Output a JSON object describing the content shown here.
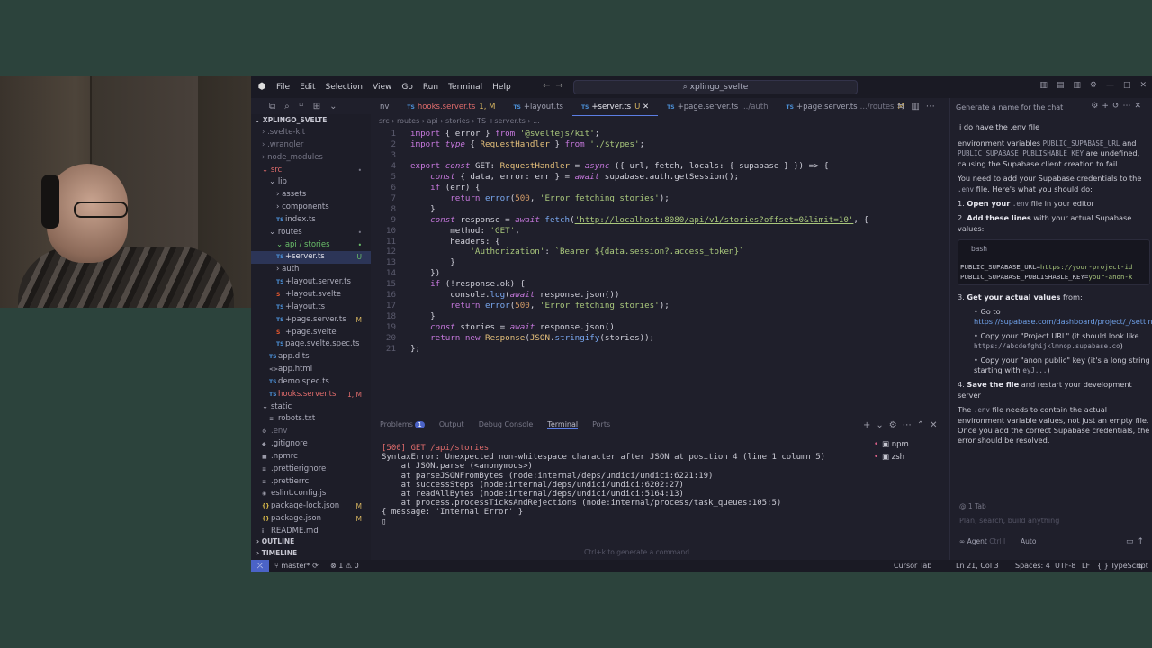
{
  "app": {
    "menu": [
      "File",
      "Edit",
      "Selection",
      "View",
      "Go",
      "Run",
      "Terminal",
      "Help"
    ],
    "search_text": "xplingo_svelte"
  },
  "tabs": [
    {
      "name": "nv",
      "sub": "",
      "mod": "",
      "active": false
    },
    {
      "name": "hooks.server.ts",
      "sub": "",
      "mod": "1, M",
      "active": false
    },
    {
      "name": "+layout.ts",
      "sub": "",
      "mod": "",
      "active": false
    },
    {
      "name": "+server.ts",
      "sub": "",
      "mod": "U",
      "active": true
    },
    {
      "name": "+page.server.ts",
      "sub": ".../auth",
      "mod": "",
      "active": false
    },
    {
      "name": "+page.server.ts",
      "sub": ".../routes",
      "mod": "M",
      "active": false
    }
  ],
  "breadcrumb": "src › routes › api › stories › TS +server.ts › ...",
  "explorer": {
    "title": "XPLINGO_SVELTE",
    "rows": [
      {
        "label": "› .svelte-kit",
        "indent": 1,
        "icon": "",
        "cls": "dim",
        "badge": ""
      },
      {
        "label": "› .wrangler",
        "indent": 1,
        "icon": "",
        "cls": "dim",
        "badge": ""
      },
      {
        "label": "› node_modules",
        "indent": 1,
        "icon": "",
        "cls": "dim",
        "badge": ""
      },
      {
        "label": "⌄ src",
        "indent": 1,
        "icon": "",
        "cls": "red",
        "badge": "•"
      },
      {
        "label": "⌄ lib",
        "indent": 2,
        "icon": "",
        "cls": "",
        "badge": ""
      },
      {
        "label": "› assets",
        "indent": 3,
        "icon": "",
        "cls": "",
        "badge": ""
      },
      {
        "label": "› components",
        "indent": 3,
        "icon": "",
        "cls": "",
        "badge": ""
      },
      {
        "label": "index.ts",
        "indent": 3,
        "icon": "TS",
        "cls": "",
        "badge": ""
      },
      {
        "label": "⌄ routes",
        "indent": 2,
        "icon": "",
        "cls": "",
        "badge": "•"
      },
      {
        "label": "⌄ api / stories",
        "indent": 3,
        "icon": "",
        "cls": "green",
        "badge": "•"
      },
      {
        "label": "+server.ts",
        "indent": 3,
        "icon": "TS",
        "cls": "sel",
        "badge": "U"
      },
      {
        "label": "› auth",
        "indent": 3,
        "icon": "",
        "cls": "",
        "badge": ""
      },
      {
        "label": "+layout.server.ts",
        "indent": 3,
        "icon": "TS",
        "cls": "",
        "badge": ""
      },
      {
        "label": "+layout.svelte",
        "indent": 3,
        "icon": "S",
        "cls": "",
        "badge": ""
      },
      {
        "label": "+layout.ts",
        "indent": 3,
        "icon": "TS",
        "cls": "",
        "badge": ""
      },
      {
        "label": "+page.server.ts",
        "indent": 3,
        "icon": "TS",
        "cls": "",
        "badge": "M"
      },
      {
        "label": "+page.svelte",
        "indent": 3,
        "icon": "S",
        "cls": "",
        "badge": ""
      },
      {
        "label": "page.svelte.spec.ts",
        "indent": 3,
        "icon": "TS",
        "cls": "",
        "badge": ""
      },
      {
        "label": "app.d.ts",
        "indent": 2,
        "icon": "TS",
        "cls": "",
        "badge": ""
      },
      {
        "label": "app.html",
        "indent": 2,
        "icon": "<>",
        "cls": "",
        "badge": ""
      },
      {
        "label": "demo.spec.ts",
        "indent": 2,
        "icon": "TS",
        "cls": "",
        "badge": ""
      },
      {
        "label": "hooks.server.ts",
        "indent": 2,
        "icon": "TS",
        "cls": "red",
        "badge": "1, M"
      },
      {
        "label": "⌄ static",
        "indent": 1,
        "icon": "",
        "cls": "",
        "badge": ""
      },
      {
        "label": "robots.txt",
        "indent": 2,
        "icon": "≡",
        "cls": "",
        "badge": ""
      },
      {
        "label": ".env",
        "indent": 1,
        "icon": "⚙",
        "cls": "dim",
        "badge": ""
      },
      {
        "label": ".gitignore",
        "indent": 1,
        "icon": "◆",
        "cls": "",
        "badge": ""
      },
      {
        "label": ".npmrc",
        "indent": 1,
        "icon": "■",
        "cls": "",
        "badge": ""
      },
      {
        "label": ".prettierignore",
        "indent": 1,
        "icon": "≡",
        "cls": "",
        "badge": ""
      },
      {
        "label": ".prettierrc",
        "indent": 1,
        "icon": "≡",
        "cls": "",
        "badge": ""
      },
      {
        "label": "eslint.config.js",
        "indent": 1,
        "icon": "◉",
        "cls": "",
        "badge": ""
      },
      {
        "label": "package-lock.json",
        "indent": 1,
        "icon": "{}",
        "cls": "",
        "badge": "M"
      },
      {
        "label": "package.json",
        "indent": 1,
        "icon": "{}",
        "cls": "",
        "badge": "M"
      },
      {
        "label": "README.md",
        "indent": 1,
        "icon": "i",
        "cls": "",
        "badge": ""
      }
    ],
    "outline_label": "OUTLINE",
    "timeline_label": "TIMELINE"
  },
  "code_lines": [
    "import { error } from '@sveltejs/kit';",
    "import type { RequestHandler } from './$types';",
    "",
    "export const GET: RequestHandler = async ({ url, fetch, locals: { supabase } }) => {",
    "    const { data, error: err } = await supabase.auth.getSession();",
    "    if (err) {",
    "        return error(500, 'Error fetching stories');",
    "    }",
    "    const response = await fetch('http://localhost:8080/api/v1/stories?offset=0&limit=10', {",
    "        method: 'GET',",
    "        headers: {",
    "            'Authorization': `Bearer ${data.session?.access_token}`",
    "        }",
    "    })",
    "    if (!response.ok) {",
    "        console.log(await response.json())",
    "        return error(500, 'Error fetching stories');",
    "    }",
    "    const stories = await response.json()",
    "    return new Response(JSON.stringify(stories));",
    "};"
  ],
  "panel": {
    "tabs": [
      "Problems",
      "Output",
      "Debug Console",
      "Terminal",
      "Ports"
    ],
    "problems_count": "1",
    "active": "Terminal",
    "shells": [
      "npm",
      "zsh"
    ],
    "terminal_lines": [
      "[500] GET /api/stories",
      "SyntaxError: Unexpected non-whitespace character after JSON at position 4 (line 1 column 5)",
      "    at JSON.parse (<anonymous>)",
      "    at parseJSONFromBytes (node:internal/deps/undici/undici:6221:19)",
      "    at successSteps (node:internal/deps/undici/undici:6202:27)",
      "    at readAllBytes (node:internal/deps/undici/undici:5164:13)",
      "    at process.processTicksAndRejections (node:internal/process/task_queues:105:5)",
      "{ message: 'Internal Error' }",
      ""
    ],
    "hint": "Ctrl+k to generate a command"
  },
  "chat": {
    "header_placeholder": "Generate a name for the chat",
    "user_message": "i do have the .env file",
    "intro": "environment variables",
    "var_url": "PUBLIC_SUPABASE_URL",
    "and": "and",
    "var_key": "PUBLIC_SUPABASE_PUBLISHABLE_KEY",
    "intro_tail": "are undefined, causing the Supabase client creation to fail.",
    "need_prefix": "You need to add your Supabase credentials to the",
    "env_name": ".env",
    "need_suffix": "file. Here's what you should do:",
    "step1_num": "1.",
    "step1_bold": "Open your",
    "step1_tail": "file in your editor",
    "step2_num": "2.",
    "step2_bold": "Add these lines",
    "step2_tail": "with your actual Supabase values:",
    "code_lang": "bash",
    "code_line1_key": "PUBLIC_SUPABASE_URL=",
    "code_line1_val": "https://your-project-id",
    "code_line2_key": "PUBLIC_SUPABASE_PUBLISHABLE_KEY=",
    "code_line2_val": "your-anon-k",
    "step3_num": "3.",
    "step3_bold": "Get your actual values",
    "step3_tail": "from:",
    "b1_prefix": "Go to",
    "b1_link": "https://supabase.com/dashboard/project/_/settin",
    "b2_text": "Copy your \"Project URL\" (it should look like",
    "b2_code": "https://abcdefghijklmnop.supabase.co",
    "b2_close": ")",
    "b3_text": "Copy your \"anon public\" key (it's a long string starting with",
    "b3_code": "eyJ...",
    "b3_close": ")",
    "step4_num": "4.",
    "step4_bold": "Save the file",
    "step4_tail": "and restart your development server",
    "closing_prefix": "The",
    "closing_tail": "file needs to contain the actual environment variable values, not just an empty file. Once you add the correct Supabase credentials, the error should be resolved.",
    "context": "1 Tab",
    "input_placeholder": "Plan, search, build anything",
    "agent_label": "Agent",
    "agent_shortcut": "Ctrl I",
    "auto_label": "Auto"
  },
  "status": {
    "branch": "master*",
    "problems": "⊗ 1 ⚠ 0",
    "cursor_tab": "Cursor Tab",
    "position": "Ln 21, Col 3",
    "spaces": "Spaces: 4",
    "encoding": "UTF-8",
    "eol": "LF",
    "language": "{ } TypeScript"
  }
}
